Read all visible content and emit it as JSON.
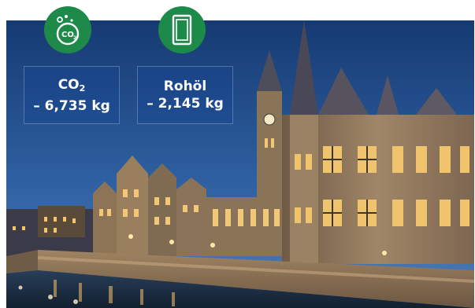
{
  "stats": {
    "co2": {
      "label_main": "CO",
      "label_sub": "2",
      "value": "– 6,735 kg",
      "icon": "co2-bubbles-icon"
    },
    "oil": {
      "label": "Rohöl",
      "value": "– 2,145 kg",
      "icon": "oil-barrel-icon"
    }
  },
  "colors": {
    "badge": "#1e8a4a",
    "sky_top": "#1b3f7a",
    "sky_bottom": "#4a79b5",
    "water": "#1a2c45",
    "building": "#a58e6c"
  }
}
